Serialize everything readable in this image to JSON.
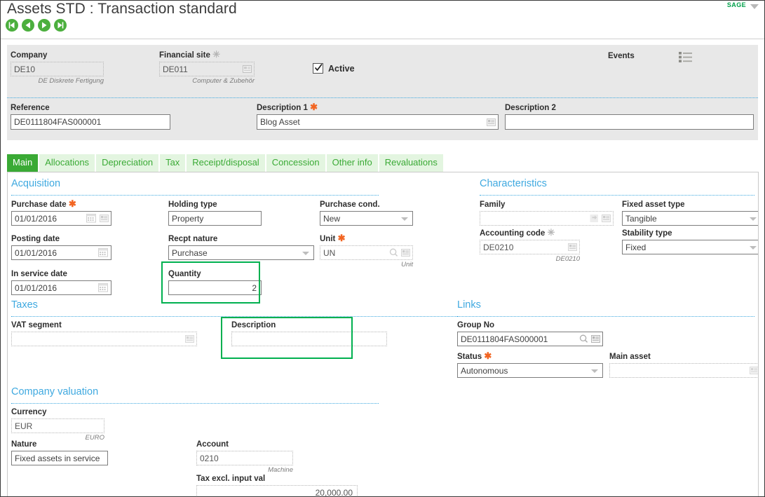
{
  "window": {
    "title": "Assets STD : Transaction standard",
    "brand": "SAGE",
    "nav": [
      {
        "name": "first",
        "label": "First"
      },
      {
        "name": "previous",
        "label": "Previous"
      },
      {
        "name": "next",
        "label": "Next"
      },
      {
        "name": "last",
        "label": "Last"
      }
    ]
  },
  "header": {
    "company": {
      "label": "Company",
      "value": "DE10",
      "hint": "DE Diskrete Fertigung"
    },
    "financial_site": {
      "label": "Financial site",
      "required_grey": "✳",
      "value": "DE011",
      "hint": "Computer & Zubehör"
    },
    "active": {
      "label": "Active",
      "checked": true
    },
    "events": {
      "label": "Events",
      "icon": "list-icon"
    },
    "reference": {
      "label": "Reference",
      "value": "DE0111804FAS000001"
    },
    "description1": {
      "label": "Description 1",
      "required": "✱",
      "value": "Blog Asset"
    },
    "description2": {
      "label": "Description 2",
      "value": ""
    }
  },
  "tabs": [
    {
      "label": "Main",
      "active": true
    },
    {
      "label": "Allocations",
      "active": false
    },
    {
      "label": "Depreciation",
      "active": false
    },
    {
      "label": "Tax",
      "active": false
    },
    {
      "label": "Receipt/disposal",
      "active": false
    },
    {
      "label": "Concession",
      "active": false
    },
    {
      "label": "Other info",
      "active": false
    },
    {
      "label": "Revaluations",
      "active": false
    }
  ],
  "sections": {
    "acquisition": {
      "title": "Acquisition"
    },
    "characteristics": {
      "title": "Characteristics"
    },
    "taxes": {
      "title": "Taxes"
    },
    "links": {
      "title": "Links"
    },
    "company_valuation": {
      "title": "Company valuation"
    }
  },
  "acquisition": {
    "purchase_date": {
      "label": "Purchase date",
      "required": "✱",
      "value": "01/01/2016"
    },
    "posting_date": {
      "label": "Posting date",
      "value": "01/01/2016"
    },
    "in_service_date": {
      "label": "In service date",
      "value": "01/01/2016"
    },
    "holding_type": {
      "label": "Holding type",
      "value": "Property"
    },
    "recpt_nature": {
      "label": "Recpt nature",
      "value": "Purchase"
    },
    "quantity": {
      "label": "Quantity",
      "value": "2",
      "highlighted": true
    },
    "purchase_cond": {
      "label": "Purchase cond.",
      "value": "New"
    },
    "unit": {
      "label": "Unit",
      "required": "✱",
      "value": "UN",
      "hint": "Unit"
    }
  },
  "characteristics": {
    "family": {
      "label": "Family",
      "value": ""
    },
    "accounting_code": {
      "label": "Accounting code",
      "required_grey": "✳",
      "value": "DE0210",
      "hint": "DE0210"
    },
    "fixed_asset_type": {
      "label": "Fixed asset type",
      "value": "Tangible"
    },
    "stability_type": {
      "label": "Stability type",
      "value": "Fixed"
    }
  },
  "taxes": {
    "vat_segment": {
      "label": "VAT segment",
      "value": ""
    },
    "description": {
      "label": "Description",
      "value": "",
      "highlighted": true
    }
  },
  "links": {
    "group_no": {
      "label": "Group No",
      "value": "DE0111804FAS000001"
    },
    "status": {
      "label": "Status",
      "required": "✱",
      "value": "Autonomous"
    },
    "main_asset": {
      "label": "Main asset",
      "value": ""
    }
  },
  "company_valuation": {
    "currency": {
      "label": "Currency",
      "value": "EUR",
      "hint": "EURO"
    },
    "nature": {
      "label": "Nature",
      "value": "Fixed assets in service"
    },
    "account": {
      "label": "Account",
      "value": "0210",
      "hint": "Machine"
    },
    "tax_excl_input_val": {
      "label": "Tax excl. input val",
      "value": "20,000.00"
    }
  },
  "colors": {
    "accent_green": "#3aaa35",
    "highlight_green": "#00b04f",
    "section_blue": "#3fa9e0",
    "required_orange": "#f26522",
    "panel_grey": "#e8e8e8"
  }
}
